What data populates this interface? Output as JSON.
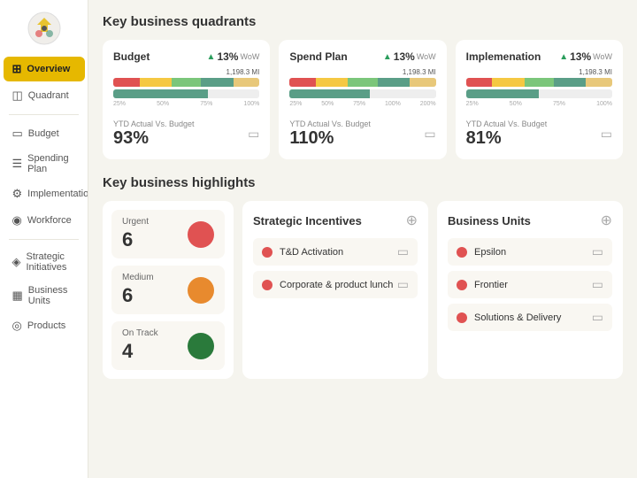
{
  "sidebar": {
    "logo_alt": "Company Logo",
    "items": [
      {
        "id": "overview",
        "label": "Overview",
        "icon": "⊞",
        "active": true
      },
      {
        "id": "quadrant",
        "label": "Quadrant",
        "icon": "◫",
        "active": false
      }
    ],
    "section2": [
      {
        "id": "budget",
        "label": "Budget",
        "icon": "💰",
        "active": false
      },
      {
        "id": "spending-plan",
        "label": "Spending Plan",
        "icon": "📋",
        "active": false
      },
      {
        "id": "implementation",
        "label": "Implementation",
        "icon": "⚙",
        "active": false
      },
      {
        "id": "workforce",
        "label": "Workforce",
        "icon": "👥",
        "active": false
      }
    ],
    "section3": [
      {
        "id": "strategic-initiatives",
        "label": "Strategic Initiatives",
        "icon": "◈",
        "active": false
      },
      {
        "id": "business-units",
        "label": "Business Units",
        "icon": "▦",
        "active": false
      },
      {
        "id": "products",
        "label": "Products",
        "icon": "◎",
        "active": false
      }
    ]
  },
  "main": {
    "quadrants_title": "Key business quadrants",
    "highlights_title": "Key business highlights",
    "quadrants": [
      {
        "title": "Budget",
        "pct": "13%",
        "wow": "WoW",
        "value_label": "1,198.3 MI",
        "ytd_label": "YTD Actual Vs. Budget",
        "ytd_pct": "93%",
        "axes": [
          "25%",
          "50%",
          "75%",
          "100%"
        ],
        "bars": [
          {
            "color": "#e05252",
            "left": "0%",
            "width": "18%"
          },
          {
            "color": "#f5c842",
            "left": "18%",
            "width": "22%"
          },
          {
            "color": "#7bc67a",
            "left": "40%",
            "width": "20%"
          },
          {
            "color": "#5a9e87",
            "left": "60%",
            "width": "22%"
          },
          {
            "color": "#e8c87a",
            "left": "82%",
            "width": "18%"
          }
        ]
      },
      {
        "title": "Spend Plan",
        "pct": "13%",
        "wow": "WoW",
        "value_label": "1,198.3 MI",
        "ytd_label": "YTD Actual Vs. Budget",
        "ytd_pct": "110%",
        "axes": [
          "25%",
          "50%",
          "75%",
          "100%",
          "200%"
        ],
        "bars": [
          {
            "color": "#e05252",
            "left": "0%",
            "width": "18%"
          },
          {
            "color": "#f5c842",
            "left": "18%",
            "width": "22%"
          },
          {
            "color": "#7bc67a",
            "left": "40%",
            "width": "20%"
          },
          {
            "color": "#5a9e87",
            "left": "60%",
            "width": "22%"
          },
          {
            "color": "#e8c87a",
            "left": "82%",
            "width": "18%"
          }
        ]
      },
      {
        "title": "Implemenation",
        "pct": "13%",
        "wow": "WoW",
        "value_label": "1,198.3 MI",
        "ytd_label": "YTD Actual Vs. Budget",
        "ytd_pct": "81%",
        "axes": [
          "25%",
          "50%",
          "75%",
          "100%"
        ],
        "bars": [
          {
            "color": "#e05252",
            "left": "0%",
            "width": "18%"
          },
          {
            "color": "#f5c842",
            "left": "18%",
            "width": "22%"
          },
          {
            "color": "#7bc67a",
            "left": "40%",
            "width": "20%"
          },
          {
            "color": "#5a9e87",
            "left": "60%",
            "width": "22%"
          },
          {
            "color": "#e8c87a",
            "left": "82%",
            "width": "18%"
          }
        ]
      }
    ],
    "urgency_items": [
      {
        "label": "Urgent",
        "count": "6",
        "dot_color": "#e05252"
      },
      {
        "label": "Medium",
        "count": "6",
        "dot_color": "#e88a2e"
      },
      {
        "label": "On Track",
        "count": "4",
        "dot_color": "#2a7a3b"
      }
    ],
    "strategic_incentives": {
      "title": "Strategic Incentives",
      "items": [
        {
          "label": "T&D Activation"
        },
        {
          "label": "Corporate & product lunch"
        }
      ]
    },
    "business_units": {
      "title": "Business Units",
      "items": [
        {
          "label": "Epsilon"
        },
        {
          "label": "Frontier"
        },
        {
          "label": "Solutions & Delivery"
        }
      ]
    }
  }
}
